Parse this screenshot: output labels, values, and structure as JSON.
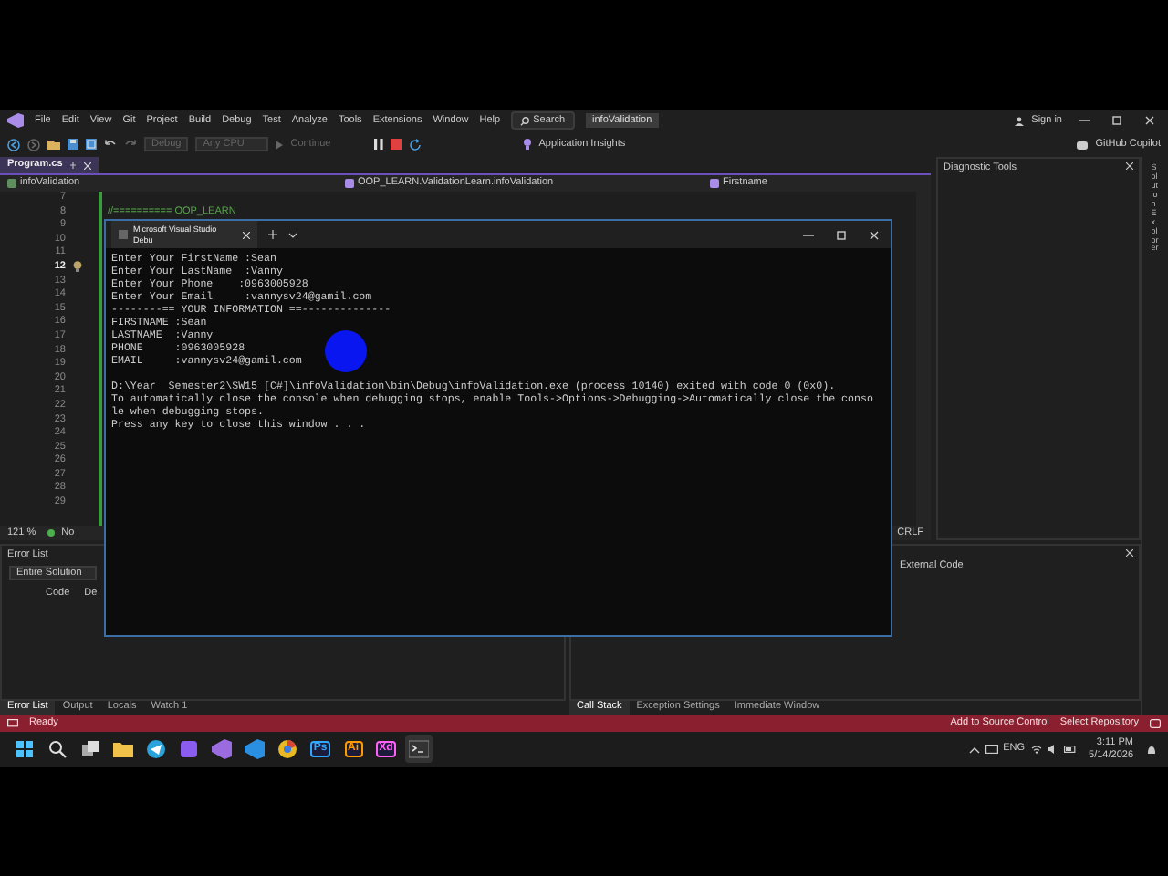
{
  "menu_bar": {
    "items": [
      "File",
      "Edit",
      "View",
      "Git",
      "Project",
      "Build",
      "Debug",
      "Test",
      "Analyze",
      "Tools",
      "Extensions",
      "Window",
      "Help"
    ],
    "search": "Search",
    "solution_name": "infoValidation",
    "sign_in": "Sign in"
  },
  "toolbar": {
    "combos": [
      {
        "label": "Debug",
        "disabled": true
      },
      {
        "label": "Any CPU",
        "disabled": true
      }
    ],
    "continue": {
      "label": "Continue",
      "disabled": true
    },
    "insights": "Application Insights",
    "copilot": "GitHub Copilot"
  },
  "editor": {
    "tab": {
      "label": "Program.cs",
      "selected": true
    },
    "nav": [
      "infoValidation",
      "OOP_LEARN.ValidationLearn.infoValidation",
      "Firstname"
    ],
    "lines": [
      {
        "number": "7",
        "current": false
      },
      {
        "number": "8",
        "current": false,
        "code": "//========== OOP_LEARN"
      },
      {
        "number": "9",
        "current": false
      },
      {
        "number": "10",
        "current": false
      },
      {
        "number": "11",
        "current": false
      },
      {
        "number": "12",
        "current": true
      },
      {
        "number": "13",
        "current": false
      },
      {
        "number": "14",
        "current": false
      },
      {
        "number": "15",
        "current": false
      },
      {
        "number": "16",
        "current": false
      },
      {
        "number": "17",
        "current": false
      },
      {
        "number": "18",
        "current": false
      },
      {
        "number": "19",
        "current": false
      },
      {
        "number": "20",
        "current": false
      },
      {
        "number": "21",
        "current": false
      },
      {
        "number": "22",
        "current": false
      },
      {
        "number": "23",
        "current": false
      },
      {
        "number": "24",
        "current": false
      },
      {
        "number": "25",
        "current": false
      },
      {
        "number": "26",
        "current": false
      },
      {
        "number": "27",
        "current": false
      },
      {
        "number": "28",
        "current": false
      },
      {
        "number": "29",
        "current": false
      }
    ],
    "zoom": "121 %",
    "issues": "No",
    "line_ending": "CRLF"
  },
  "diagnostic_tools": {
    "title": "Diagnostic Tools"
  },
  "solution_explorer": {
    "label": "Solution Explorer"
  },
  "error_list": {
    "title": "Error List",
    "scope": "Entire Solution",
    "columns": [
      "Code",
      "De"
    ]
  },
  "call_stack": {
    "rows": [
      "External Code"
    ]
  },
  "bottom_tabs_left": [
    {
      "label": "Error List",
      "selected": true
    },
    {
      "label": "Output",
      "selected": false
    },
    {
      "label": "Locals",
      "selected": false
    },
    {
      "label": "Watch 1",
      "selected": false
    }
  ],
  "bottom_tabs_right": [
    {
      "label": "Call Stack",
      "selected": true
    },
    {
      "label": "Exception Settings",
      "selected": false
    },
    {
      "label": "Immediate Window",
      "selected": false
    }
  ],
  "status_bar": {
    "status": "Ready",
    "source_control": "Add to Source Control",
    "repository": "Select Repository"
  },
  "console": {
    "tab": "Microsoft Visual Studio Debu",
    "blocks": [
      [
        "Enter Your FirstName :Sean",
        "Enter Your LastName  :Vanny",
        "Enter Your Phone    :0963005928",
        "Enter Your Email     :vannysv24@gamil.com",
        "--------== YOUR INFORMATION ==--------------",
        "FIRSTNAME :Sean",
        "LASTNAME  :Vanny",
        "PHONE     :0963005928",
        "EMAIL     :vannysv24@gamil.com"
      ],
      [
        "D:\\Year  Semester2\\SW15 [C#]\\infoValidation\\bin\\Debug\\infoValidation.exe (process 10140) exited with code 0 (0x0).",
        "To automatically close the console when debugging stops, enable Tools->Options->Debugging->Automatically close the conso",
        "le when debugging stops.",
        "Press any key to close this window . . ."
      ]
    ]
  },
  "taskbar": {
    "apps": [
      {
        "kind": "start"
      },
      {
        "kind": "search"
      },
      {
        "kind": "taskview"
      },
      {
        "kind": "folder"
      },
      {
        "kind": "telegram"
      },
      {
        "kind": "app"
      },
      {
        "kind": "vs"
      },
      {
        "kind": "vscode"
      },
      {
        "kind": "chrome"
      },
      {
        "kind": "letter",
        "label": "Ps",
        "color": "#31a8ff"
      },
      {
        "kind": "letter",
        "label": "Ai",
        "color": "#ff9a00"
      },
      {
        "kind": "letter",
        "label": "Xd",
        "color": "#ff61f6"
      },
      {
        "kind": "terminal",
        "active": true
      }
    ],
    "language": "ENG",
    "time": "3:11 PM",
    "date": "5/14/2026"
  }
}
